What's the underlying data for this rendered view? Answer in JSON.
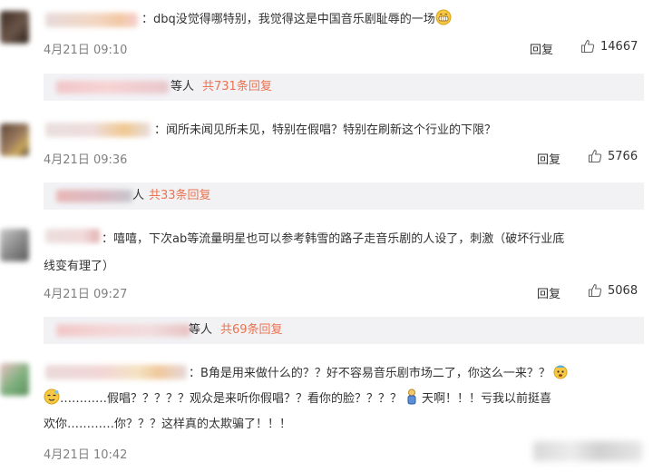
{
  "reply_label": "回复",
  "comments": [
    {
      "text_lines": [
        "：dbq没觉得哪特别，我觉得这是中国音乐剧耻辱的一场"
      ],
      "time": "4月21日 09:10",
      "likes": "14667",
      "reply_bar": {
        "suffix": "等人",
        "count_text": "共731条回复"
      }
    },
    {
      "text_lines": [
        "：闻所未闻见所未见，特别在假唱？特别在刷新这个行业的下限？"
      ],
      "time": "4月21日 09:36",
      "likes": "5766",
      "reply_bar": {
        "suffix": "人",
        "count_text": "共33条回复"
      }
    },
    {
      "text_lines": [
        "：嘻嘻，下次ab等流量明星也可以参考韩雪的路子走音乐剧的人设了，刺激（破坏行业底",
        "线变有理了）"
      ],
      "time": "4月21日 09:27",
      "likes": "5068",
      "reply_bar": {
        "suffix": "等人",
        "count_text": "共69条回复"
      }
    },
    {
      "text_lines": [
        "：B角是用来做什么的？？好不容易音乐剧市场二了，你这么一来？？",
        "…………假唱？？？？？观众是来听你假唱？？看你的脸？？？？",
        "天啊！！！亏我以前挺喜",
        "欢你…………你？？？这样真的太欺骗了！！！"
      ],
      "time": "4月21日 10:42"
    }
  ]
}
